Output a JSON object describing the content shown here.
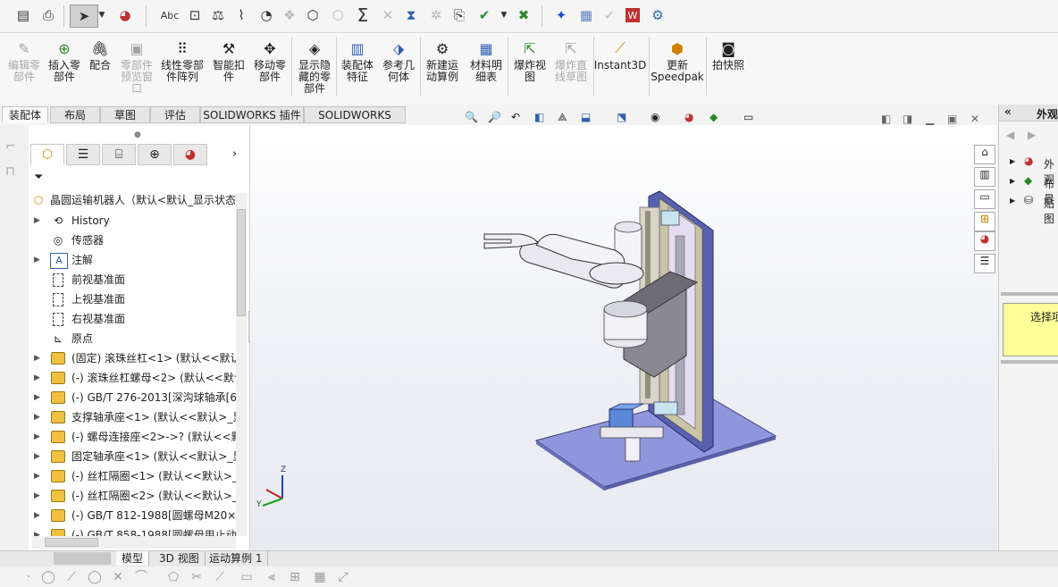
{
  "top_toolbar": {
    "icons": [
      "new-icon",
      "open-icon",
      "select-arrow-icon",
      "appearance-icon",
      "spelling-check-icon",
      "measure-icon",
      "mass-properties-icon",
      "section-properties-icon",
      "check-icon",
      "interference-icon",
      "clearance-icon",
      "sum-icon",
      "hole-alignment-icon",
      "compare-icon",
      "symmetry-icon",
      "rebuild-options-icon",
      "design-check-icon",
      "graphics-icon",
      "flow-icon",
      "excel-icon",
      "save-icon",
      "word-icon",
      "settings-icon"
    ]
  },
  "ribbon": {
    "buttons": [
      {
        "id": "edit-part",
        "label": "编辑零\n部件",
        "disabled": true
      },
      {
        "id": "insert-part",
        "label": "插入零\n部件",
        "disabled": false
      },
      {
        "id": "mate",
        "label": "配合",
        "disabled": false
      },
      {
        "id": "part-preview",
        "label": "零部件\n预览窗\n口",
        "disabled": true
      },
      {
        "id": "linear-pattern",
        "label": "线性零部\n件阵列",
        "disabled": false
      },
      {
        "id": "smart-fastener",
        "label": "智能扣\n件",
        "disabled": false
      },
      {
        "id": "move-part",
        "label": "移动零\n部件",
        "disabled": false
      },
      {
        "id": "show-hidden",
        "label": "显示隐\n藏的零\n部件",
        "disabled": false
      },
      {
        "id": "assembly-feature",
        "label": "装配体\n特征",
        "disabled": false
      },
      {
        "id": "reference-geometry",
        "label": "参考几\n何体",
        "disabled": false
      },
      {
        "id": "new-motion",
        "label": "新建运\n动算例",
        "disabled": false
      },
      {
        "id": "bom",
        "label": "材料明\n细表",
        "disabled": false
      },
      {
        "id": "exploded-view",
        "label": "爆炸视\n图",
        "disabled": false
      },
      {
        "id": "explode-line",
        "label": "爆炸直\n线草图",
        "disabled": true
      },
      {
        "id": "instant3d",
        "label": "Instant3D",
        "disabled": false
      },
      {
        "id": "speedpak",
        "label": "更新\nSpeedpak",
        "disabled": false
      },
      {
        "id": "snapshot",
        "label": "拍快照",
        "disabled": false
      }
    ]
  },
  "command_tabs": [
    "装配体",
    "布局",
    "草图",
    "评估",
    "SOLIDWORKS 插件",
    "SOLIDWORKS MBD"
  ],
  "command_tab_active": 0,
  "manager_tabs": [
    "feature-manager-icon",
    "property-manager-icon",
    "configuration-manager-icon",
    "dimxpert-icon",
    "display-manager-icon"
  ],
  "tree": {
    "root": "晶圆运输机器人（默认<默认_显示状态",
    "items": [
      {
        "label": "History",
        "icon": "history-icon",
        "expand": true
      },
      {
        "label": "传感器",
        "icon": "sensor-icon",
        "expand": false
      },
      {
        "label": "注解",
        "icon": "annotation-icon",
        "expand": true
      },
      {
        "label": "前视基准面",
        "icon": "plane-icon",
        "expand": false
      },
      {
        "label": "上视基准面",
        "icon": "plane-icon",
        "expand": false
      },
      {
        "label": "右视基准面",
        "icon": "plane-icon",
        "expand": false
      },
      {
        "label": "原点",
        "icon": "origin-icon",
        "expand": false
      },
      {
        "label": "(固定) 滚珠丝杠<1> (默认<<默认",
        "icon": "part-icon",
        "expand": true
      },
      {
        "label": "(-) 滚珠丝杠螺母<2> (默认<<默认",
        "icon": "part-icon",
        "expand": true
      },
      {
        "label": "(-) GB/T 276-2013[深沟球轴承[6",
        "icon": "part-icon",
        "expand": true
      },
      {
        "label": "支撑轴承座<1> (默认<<默认>_显",
        "icon": "part-icon",
        "expand": true
      },
      {
        "label": "(-) 螺母连接座<2>->? (默认<<默",
        "icon": "part-icon",
        "expand": true
      },
      {
        "label": "固定轴承座<1> (默认<<默认>_显",
        "icon": "part-icon",
        "expand": true
      },
      {
        "label": "(-) 丝杠隔圈<1> (默认<<默认>_显",
        "icon": "part-icon",
        "expand": true
      },
      {
        "label": "(-) 丝杠隔圈<2> (默认<<默认>_显",
        "icon": "part-icon",
        "expand": true
      },
      {
        "label": "(-) GB/T 812-1988[圆螺母M20×",
        "icon": "part-icon",
        "expand": true
      },
      {
        "label": "(-) GB/T 858-1988[圆螺母用止动",
        "icon": "part-icon",
        "expand": true
      }
    ]
  },
  "heads_up_toolbar": [
    "zoom-to-fit-icon",
    "zoom-area-icon",
    "previous-view-icon",
    "section-view-icon",
    "dynamic-annotation-icon",
    "view-orientation-icon",
    "display-style-icon",
    "hide-show-icon",
    "edit-appearance-icon",
    "apply-scene-icon",
    "view-settings-icon"
  ],
  "triad": {
    "z": "Z",
    "y": "Y",
    "x": "X"
  },
  "right_panel": {
    "title": "外观",
    "items": [
      "外观",
      "布景",
      "贴图"
    ],
    "message": "选择项"
  },
  "bottom_tabs": [
    "模型",
    "3D 视图",
    "运动算例 1"
  ],
  "bottom_tab_active": 0,
  "colors": {
    "accent": "#1c4fa3",
    "tree_part": "#f0c040",
    "base_plate": "#8d92dc",
    "message_bg": "#ffff99"
  }
}
